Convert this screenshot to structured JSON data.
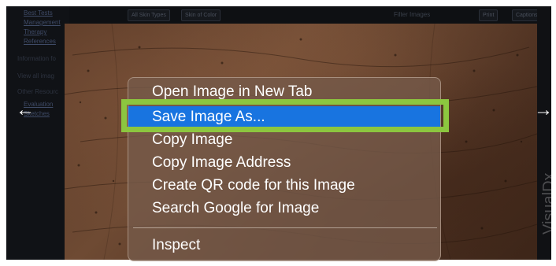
{
  "sidebar": {
    "links": [
      "Best Tests",
      "Management",
      "Therapy",
      "References"
    ],
    "information_label": "Information fo",
    "view_all_label": "View all imag",
    "other_resources_label": "Other Resourc",
    "resource_links": [
      "Evaluation",
      "Sketches"
    ]
  },
  "toolbar": {
    "filter_all_types": "All Skin Types",
    "filter_skin_color": "Skin of Color",
    "filter_images": "Filter Images",
    "print": "Print",
    "captions": "Captions"
  },
  "lightbox": {
    "prev_glyph": "←",
    "next_glyph": "→",
    "watermark": "VisualDx"
  },
  "context_menu": {
    "items": [
      "Open Image in New Tab",
      "Save Image As...",
      "Copy Image",
      "Copy Image Address",
      "Create QR code for this Image",
      "Search Google for Image"
    ],
    "inspect": "Inspect",
    "highlighted_index": 1
  },
  "colors": {
    "menu_highlight": "#1874e0",
    "annotation_outline": "#8cc63f"
  }
}
